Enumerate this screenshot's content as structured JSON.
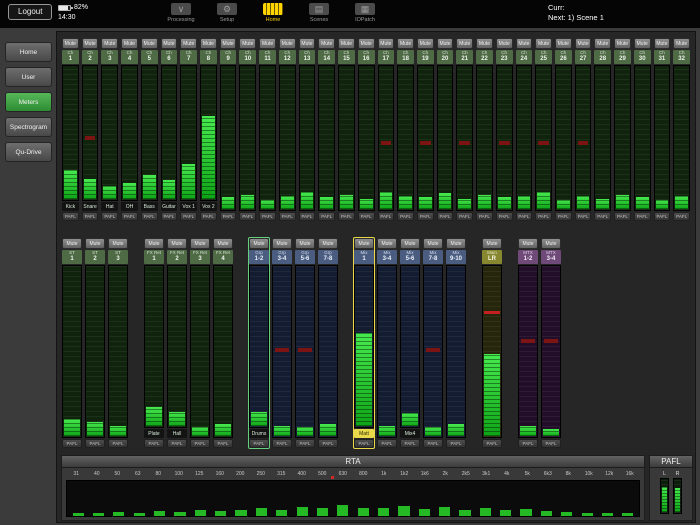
{
  "topbar": {
    "logout": "Logout",
    "battery_pct": "82%",
    "time": "14:30",
    "nav": [
      {
        "label": "Processing",
        "icon": "processing-icon",
        "glyph": "∨",
        "active": false
      },
      {
        "label": "Setup",
        "icon": "setup-icon",
        "glyph": "⚙",
        "active": false
      },
      {
        "label": "Home",
        "icon": "home-icon",
        "glyph": "",
        "active": true
      },
      {
        "label": "Scenes",
        "icon": "scenes-icon",
        "glyph": "▤",
        "active": false
      },
      {
        "label": "IOPatch",
        "icon": "iopatch-icon",
        "glyph": "▦",
        "active": false
      }
    ],
    "curr_label": "Curr:",
    "next_label": "Next: 1) Scene 1"
  },
  "sidebar": {
    "items": [
      {
        "label": "Home",
        "active": false
      },
      {
        "label": "User",
        "active": false
      },
      {
        "label": "Meters",
        "active": true
      },
      {
        "label": "Spectrogram",
        "active": false
      },
      {
        "label": "Qu-Drive",
        "active": false
      }
    ]
  },
  "strips": {
    "mute_label": "Mute",
    "pafl_label": "PAFL",
    "channel_prefix": "Ch",
    "channels": [
      {
        "num": "1",
        "name": "Kick",
        "lvl": 22
      },
      {
        "num": "2",
        "name": "Snare",
        "lvl": 15,
        "gr": true
      },
      {
        "num": "3",
        "name": "Hat",
        "lvl": 10
      },
      {
        "num": "4",
        "name": "OH",
        "lvl": 12
      },
      {
        "num": "5",
        "name": "Bass",
        "lvl": 18
      },
      {
        "num": "6",
        "name": "Guitar",
        "lvl": 14
      },
      {
        "num": "7",
        "name": "Vox 1",
        "lvl": 26
      },
      {
        "num": "8",
        "name": "Vox 2",
        "lvl": 62
      },
      {
        "num": "9",
        "lvl": 8
      },
      {
        "num": "10",
        "lvl": 10
      },
      {
        "num": "11",
        "lvl": 6
      },
      {
        "num": "12",
        "lvl": 9
      },
      {
        "num": "13",
        "lvl": 12
      },
      {
        "num": "14",
        "lvl": 8
      },
      {
        "num": "15",
        "lvl": 10
      },
      {
        "num": "16",
        "lvl": 7
      },
      {
        "num": "17",
        "lvl": 12,
        "gr": true
      },
      {
        "num": "18",
        "lvl": 9
      },
      {
        "num": "19",
        "lvl": 8,
        "gr": true
      },
      {
        "num": "20",
        "lvl": 11
      },
      {
        "num": "21",
        "lvl": 7,
        "gr": true
      },
      {
        "num": "22",
        "lvl": 10
      },
      {
        "num": "23",
        "lvl": 8,
        "gr": true
      },
      {
        "num": "24",
        "lvl": 9
      },
      {
        "num": "25",
        "lvl": 12,
        "gr": true
      },
      {
        "num": "26",
        "lvl": 6
      },
      {
        "num": "27",
        "lvl": 9,
        "gr": true
      },
      {
        "num": "28",
        "lvl": 7
      },
      {
        "num": "29",
        "lvl": 10
      },
      {
        "num": "30",
        "lvl": 8
      },
      {
        "num": "31",
        "lvl": 6
      },
      {
        "num": "32",
        "lvl": 9
      }
    ],
    "groups": [
      {
        "color": "green",
        "strips": [
          {
            "top": "ST",
            "num": "1",
            "lvl": 10
          },
          {
            "top": "ST",
            "num": "2",
            "lvl": 8
          },
          {
            "top": "ST",
            "num": "3",
            "lvl": 6
          }
        ]
      },
      {
        "color": "green",
        "strips": [
          {
            "top": "FX Ret",
            "num": "1",
            "name": "Plate",
            "lvl": 12
          },
          {
            "top": "FX Ret",
            "num": "2",
            "name": "Hall",
            "lvl": 9
          },
          {
            "top": "FX Ret",
            "num": "3",
            "lvl": 5
          },
          {
            "top": "FX Ret",
            "num": "4",
            "lvl": 7
          }
        ]
      },
      {
        "color": "blue",
        "strips": [
          {
            "top": "Grp",
            "num": "1-2",
            "name": "Drums",
            "sel": "green",
            "lvl": 9
          },
          {
            "top": "Grp",
            "num": "3-4",
            "lvl": 6,
            "gr": true,
            "grpos": 50
          },
          {
            "top": "Grp",
            "num": "5-6",
            "lvl": 5,
            "gr": true,
            "grpos": 50
          },
          {
            "top": "Grp",
            "num": "7-8",
            "lvl": 7
          }
        ]
      },
      {
        "color": "blue",
        "strips": [
          {
            "top": "Mix",
            "num": "1",
            "name": "Matt",
            "sel": "yellow",
            "nameActive": true,
            "lvl": 58
          },
          {
            "top": "Mix",
            "num": "3-4",
            "lvl": 6
          },
          {
            "top": "Mix",
            "num": "5-6",
            "name": "Mix4",
            "lvl": 8
          },
          {
            "top": "Mix",
            "num": "7-8",
            "lvl": 5,
            "gr": true,
            "grpos": 50
          },
          {
            "top": "Mix",
            "num": "9-10",
            "lvl": 7
          }
        ]
      },
      {
        "color": "olive",
        "strips": [
          {
            "top": "Main",
            "num": "LR",
            "lvl": 48,
            "peak": 72
          }
        ]
      },
      {
        "color": "purple",
        "strips": [
          {
            "top": "MTX",
            "num": "1-2",
            "lvl": 6,
            "gr": true,
            "grpos": 55
          },
          {
            "top": "MTX",
            "num": "3-4",
            "lvl": 4,
            "gr": true,
            "grpos": 55
          }
        ]
      }
    ]
  },
  "rta": {
    "title": "RTA",
    "freqs": [
      "31",
      "40",
      "50",
      "63",
      "80",
      "100",
      "125",
      "160",
      "200",
      "250",
      "315",
      "400",
      "500",
      "630",
      "800",
      "1k",
      "1k2",
      "1k6",
      "2k",
      "2k5",
      "3k1",
      "4k",
      "5k",
      "6k3",
      "8k",
      "10k",
      "12k",
      "16k"
    ],
    "bars": [
      8,
      10,
      12,
      10,
      14,
      12,
      16,
      14,
      18,
      22,
      18,
      26,
      22,
      32,
      24,
      22,
      28,
      20,
      26,
      17,
      22,
      16,
      19,
      13,
      11,
      10,
      8,
      8
    ],
    "marker_band": 13
  },
  "pafl": {
    "title": "PAFL",
    "left_label": "L",
    "right_label": "R",
    "levels": [
      74,
      70
    ]
  }
}
